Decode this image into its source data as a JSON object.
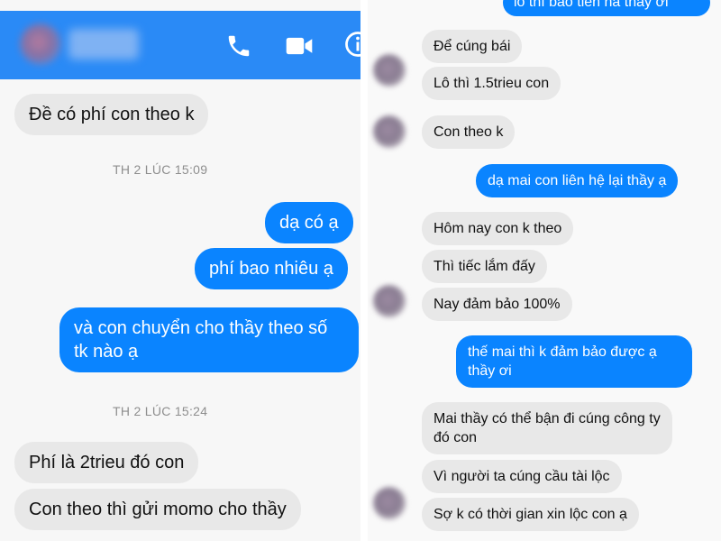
{
  "colors": {
    "header": "#2a8af6",
    "outgoing": "#0a84ff",
    "incoming": "#e8e8e8",
    "timestamp": "#8e8e8e"
  },
  "icons": {
    "call": "phone-icon",
    "video": "video-camera-icon",
    "info": "info-icon"
  },
  "left": {
    "messages": [
      {
        "text": "Đề có phí con theo k"
      },
      {
        "text": "TH 2 LÚC 15:09"
      },
      {
        "text": "dạ có ạ"
      },
      {
        "text": "phí bao nhiêu ạ"
      },
      {
        "text": "và con chuyển cho thầy theo số tk nào ạ"
      },
      {
        "text": "TH 2 LÚC 15:24"
      },
      {
        "text": "Phí là 2trieu đó con"
      },
      {
        "text": "Con theo thì gửi momo cho thầy"
      }
    ]
  },
  "right": {
    "messages": [
      {
        "text": "lô thì báo tiền ha thầy ơi"
      },
      {
        "text": "Để cúng bái"
      },
      {
        "text": "Lô thì 1.5trieu con"
      },
      {
        "text": "Con theo k"
      },
      {
        "text": "dạ mai con liên hệ lại thầy ạ"
      },
      {
        "text": "Hôm nay con k theo"
      },
      {
        "text": "Thì tiếc lắm đấy"
      },
      {
        "text": "Nay đảm bảo 100%"
      },
      {
        "text": "thế mai thì k đảm bảo được ạ thầy ơi"
      },
      {
        "text": "Mai thầy có thể bận đi cúng công ty đó con"
      },
      {
        "text": "Vì người ta cúng cầu tài lộc"
      },
      {
        "text": "Sợ k có thời gian xin lộc con ạ"
      }
    ]
  }
}
